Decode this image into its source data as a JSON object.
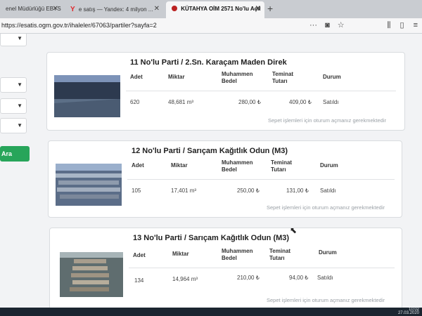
{
  "browser": {
    "tabs": [
      {
        "label": "enel Müdürlüğü EBYS"
      },
      {
        "label": "e satış — Yandex: 4 milyon ..."
      },
      {
        "label": "KÜTAHYA OİM 2571 No'lu Açıl"
      }
    ],
    "url": "https://esatis.ogm.gov.tr/ihaleler/67063/partiler?sayfa=2"
  },
  "sidebar": {
    "button_label": "Ara"
  },
  "columns": {
    "adet": "Adet",
    "miktar": "Miktar",
    "bedel": "Muhammen Bedel",
    "teminat": "Teminat Tutarı",
    "durum": "Durum"
  },
  "lots": [
    {
      "title": "11 No'lu Parti / 2.Sn. Karaçam Maden Direk",
      "adet": "620",
      "miktar": "48,681 m³",
      "bedel": "280,00 ₺",
      "teminat": "409,00 ₺",
      "durum": "Satıldı",
      "note": "Sepet işlemleri için oturum açmanız gerekmektedir"
    },
    {
      "title": "12 No'lu Parti / Sarıçam Kağıtlık Odun (M3)",
      "adet": "105",
      "miktar": "17,401 m³",
      "bedel": "250,00 ₺",
      "teminat": "131,00 ₺",
      "durum": "Satıldı",
      "note": "Sepet işlemleri için oturum açmanız gerekmektedir"
    },
    {
      "title": "13 No'lu Parti / Sarıçam Kağıtlık Odun (M3)",
      "adet": "134",
      "miktar": "14,964 m³",
      "bedel": "210,00 ₺",
      "teminat": "94,00 ₺",
      "durum": "Satıldı",
      "note": "Sepet işlemleri için oturum açmanız gerekmektedir"
    }
  ],
  "taskbar": {
    "time": "10:02",
    "date": "27.03.2020"
  }
}
